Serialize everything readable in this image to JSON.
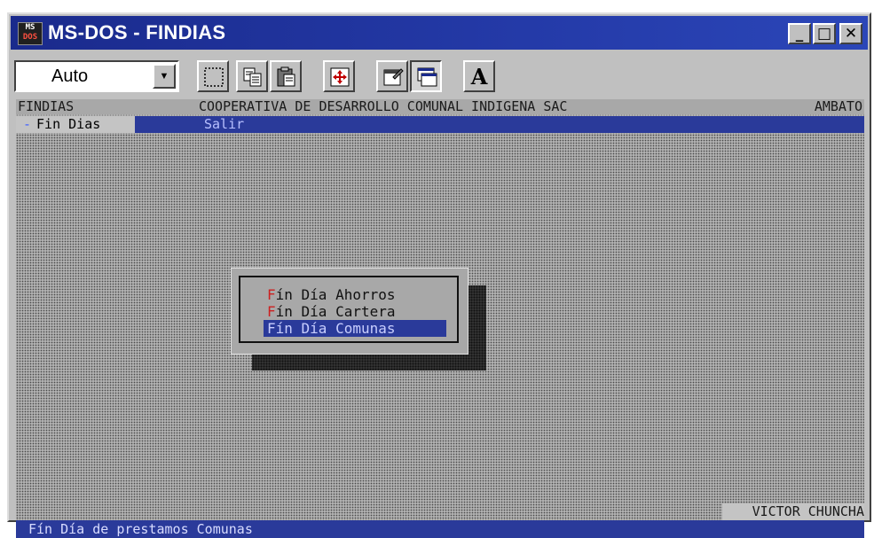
{
  "window": {
    "title": "MS-DOS - FINDIAS",
    "icon_top": "MS",
    "icon_bottom": "DOS"
  },
  "title_buttons": {
    "minimize": "_",
    "maximize": "□",
    "close": "✕"
  },
  "toolbar": {
    "font_size_value": "Auto",
    "font_button_label": "A",
    "icons": [
      "mark-icon",
      "copy-icon",
      "paste-icon",
      "fullscreen-icon",
      "properties-icon",
      "background-icon",
      "font-icon"
    ]
  },
  "dos": {
    "header": {
      "program": "FINDIAS",
      "organization": "COOPERATIVA DE DESARROLLO COMUNAL INDIGENA SAC",
      "city": "AMBATO"
    },
    "menu": {
      "selected_prefix": "-",
      "selected": "Fin Dias",
      "other": "Salir"
    },
    "popup": {
      "items": [
        {
          "hotkey": "F",
          "rest": "ín Día Ahorros"
        },
        {
          "hotkey": "F",
          "rest": "ín Día Cartera"
        },
        {
          "hotkey": "F",
          "rest": "ín Día Comunas"
        }
      ]
    },
    "user": "VICTOR CHUNCHA",
    "status": "Fín Día de prestamos Comunas"
  },
  "colors": {
    "title_blue": "#1a2a8c",
    "dos_blue": "#2a3a9a",
    "hotkey_red": "#cc2020"
  }
}
